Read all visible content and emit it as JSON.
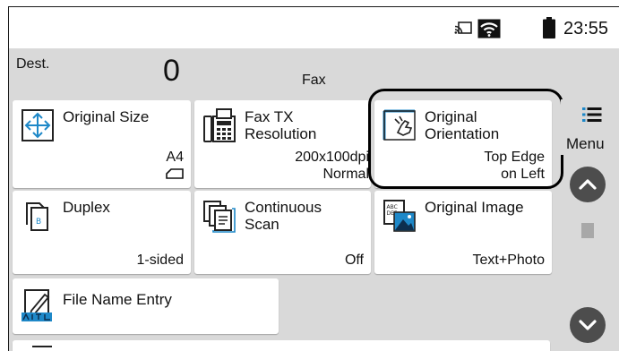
{
  "status": {
    "time": "23:55"
  },
  "destination": {
    "label": "Dest.",
    "count": "0",
    "type": "Fax"
  },
  "tiles": {
    "original_size": {
      "title": "Original Size",
      "value": "A4"
    },
    "fax_tx_resolution": {
      "title": "Fax TX\nResolution",
      "value": "200x100dpi\nNormal"
    },
    "original_orientation": {
      "title": "Original\nOrientation",
      "value": "Top Edge\non Left"
    },
    "duplex": {
      "title": "Duplex",
      "value": "1-sided"
    },
    "continuous_scan": {
      "title": "Continuous\nScan",
      "value": "Off"
    },
    "original_image": {
      "title": "Original Image",
      "value": "Text+Photo"
    },
    "file_name_entry": {
      "title": "File Name Entry"
    }
  },
  "menu": {
    "label": "Menu"
  },
  "colors": {
    "panel_bg": "#d9d9d9",
    "tile_bg": "#ffffff",
    "scroll_button": "#4d4d4d",
    "highlight": "#000000"
  },
  "icons": {
    "cast": "cast-icon",
    "wifi": "wifi-icon",
    "battery": "battery-icon",
    "menu": "hamburger-menu-icon",
    "up": "chevron-up-icon",
    "down": "chevron-down-icon"
  }
}
